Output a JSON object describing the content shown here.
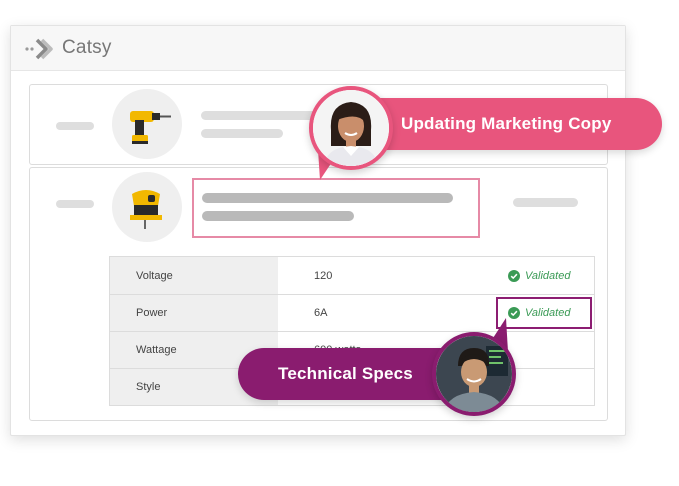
{
  "app": {
    "name": "Catsy",
    "logo_icon": "catsy-logo-icon"
  },
  "products": [
    {
      "thumbnail_icon": "cordless-drill-icon"
    },
    {
      "thumbnail_icon": "jigsaw-icon"
    }
  ],
  "specs": {
    "rows": [
      {
        "label": "Voltage",
        "value": "120",
        "status": "Validated"
      },
      {
        "label": "Power",
        "value": "6A",
        "status": "Validated"
      },
      {
        "label": "Wattage",
        "value": "600 watts",
        "status": ""
      },
      {
        "label": "Style",
        "value": "",
        "status": ""
      }
    ]
  },
  "callouts": {
    "marketing": {
      "label": "Updating Marketing Copy",
      "color": "#e8557d"
    },
    "technical": {
      "label": "Technical Specs",
      "color": "#8a1c6f"
    }
  },
  "colors": {
    "validated": "#3a9a55",
    "accent_pink": "#e8557d",
    "accent_purple": "#8a1c6f"
  }
}
